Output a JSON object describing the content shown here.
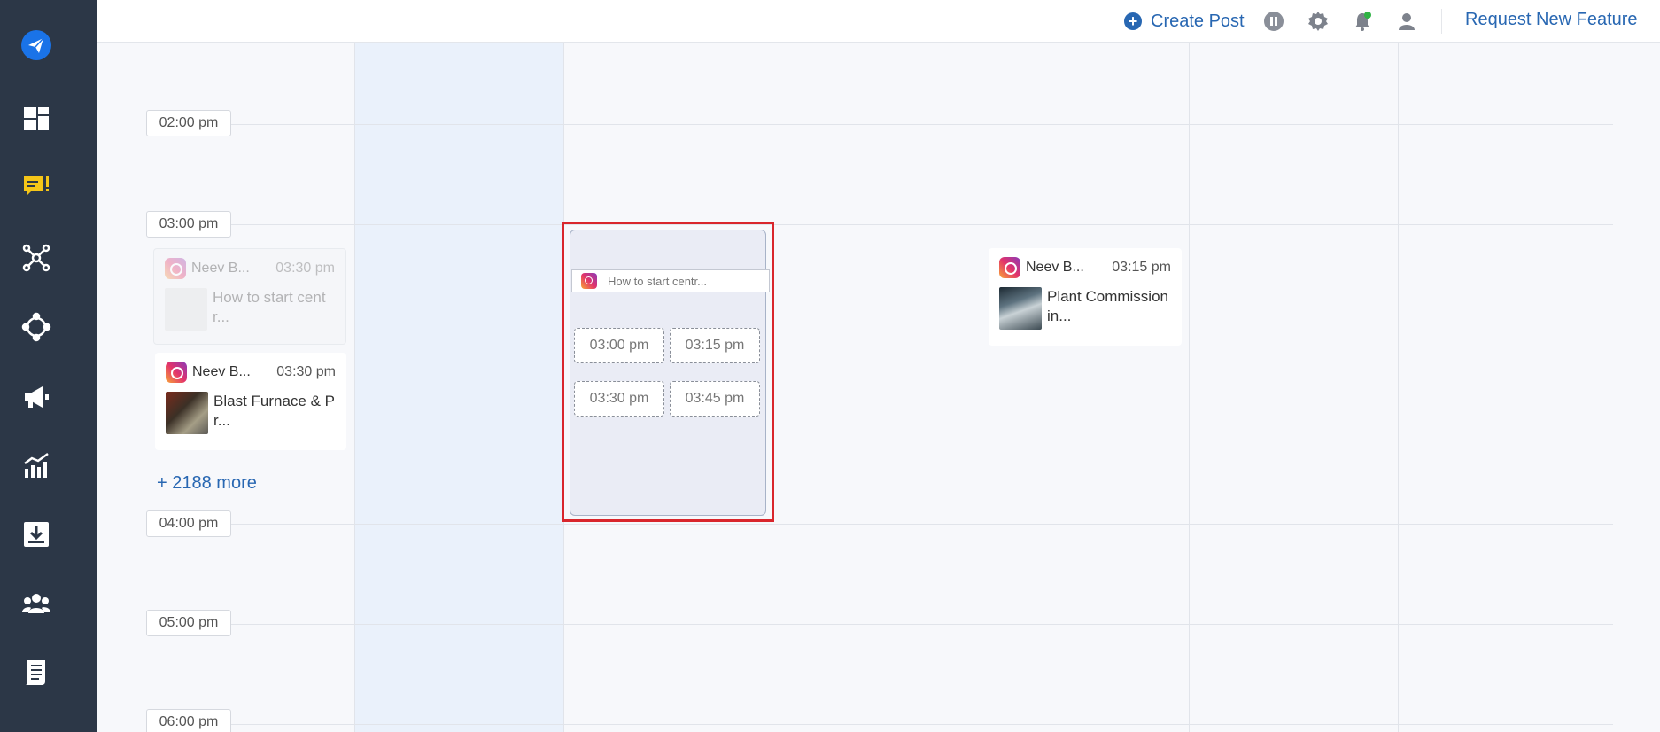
{
  "topbar": {
    "create_post_label": "Create Post",
    "request_feature_label": "Request New Feature"
  },
  "sidebar": {
    "items": [
      "logo-icon",
      "dashboard-icon",
      "inbox-icon",
      "network-icon",
      "listening-icon",
      "campaign-icon",
      "analytics-icon",
      "download-icon",
      "team-icon",
      "reports-icon"
    ]
  },
  "calendar": {
    "time_labels": [
      "02:00 pm",
      "03:00 pm",
      "04:00 pm",
      "05:00 pm",
      "06:00 pm"
    ],
    "more_link": "+ 2188 more"
  },
  "posts": {
    "ghost": {
      "account": "Neev B...",
      "time": "03:30 pm",
      "title": "How to start cent r..."
    },
    "blast": {
      "account": "Neev B...",
      "time": "03:30 pm",
      "title": "Blast Furnace & P r..."
    },
    "plant": {
      "account": "Neev B...",
      "time": "03:15 pm",
      "title": "Plant Commission in..."
    }
  },
  "drop_panel": {
    "dragged_title": "How to start centr...",
    "slots": [
      "03:00 pm",
      "03:15 pm",
      "03:30 pm",
      "03:45 pm"
    ]
  },
  "colors": {
    "sidebar_bg": "#2c3747",
    "accent": "#2867b2",
    "highlight": "#d9262c"
  }
}
